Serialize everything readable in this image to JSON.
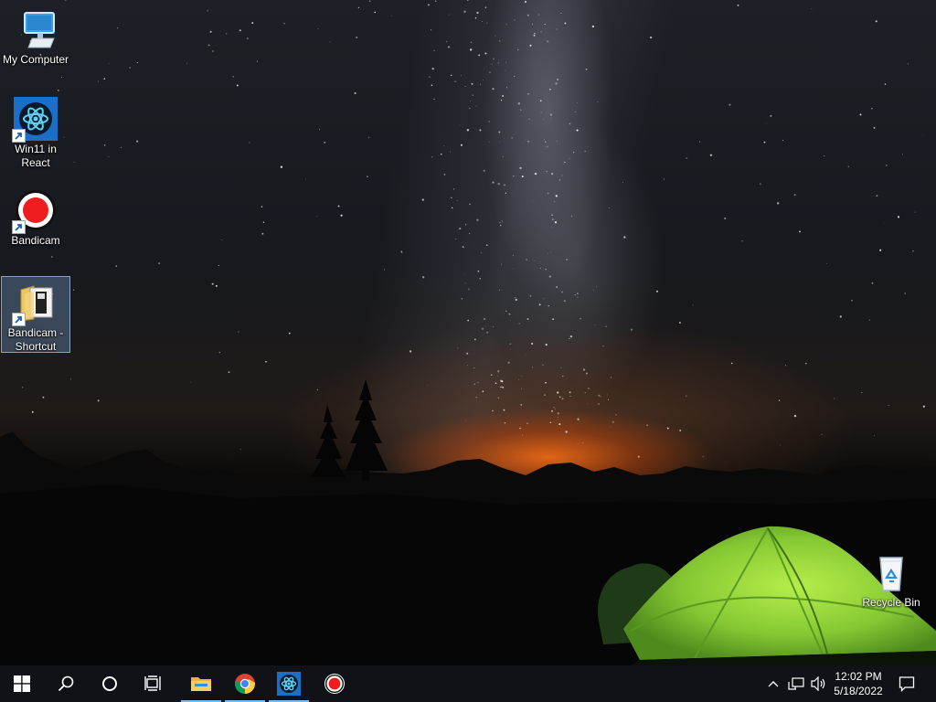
{
  "desktop": {
    "icons": [
      {
        "label": "My Computer",
        "icon": "computer-icon"
      },
      {
        "label": "Win11 in\nReact",
        "icon": "react-icon"
      },
      {
        "label": "Bandicam",
        "icon": "bandicam-icon"
      },
      {
        "label": "Bandicam -\nShortcut",
        "icon": "folder-shortcut-icon",
        "selected": true
      },
      {
        "label": "Recycle Bin",
        "icon": "recycle-bin-icon"
      }
    ]
  },
  "taskbar": {
    "buttons": [
      {
        "name": "start",
        "icon": "windows-logo-icon"
      },
      {
        "name": "search",
        "icon": "search-icon"
      },
      {
        "name": "cortana",
        "icon": "cortana-circle-icon"
      },
      {
        "name": "task-view",
        "icon": "task-view-icon"
      },
      {
        "name": "file-explorer",
        "icon": "folder-icon",
        "open": true
      },
      {
        "name": "chrome",
        "icon": "chrome-icon",
        "open": true
      },
      {
        "name": "win11-react",
        "icon": "react-icon",
        "open": true
      },
      {
        "name": "bandicam",
        "icon": "bandicam-icon",
        "open": false
      }
    ],
    "tray": {
      "icons": [
        "chevron-up-icon",
        "network-icon",
        "volume-icon"
      ],
      "time": "12:02 PM",
      "date": "5/18/2022",
      "notification_icon": "action-center-icon"
    }
  },
  "colors": {
    "taskbar_bg": "#101218",
    "active_indicator": "#76b9ed",
    "react_blue": "#2f7fd6",
    "bandicam_red": "#ef1d1d",
    "tent_green": "#8fd43a"
  }
}
